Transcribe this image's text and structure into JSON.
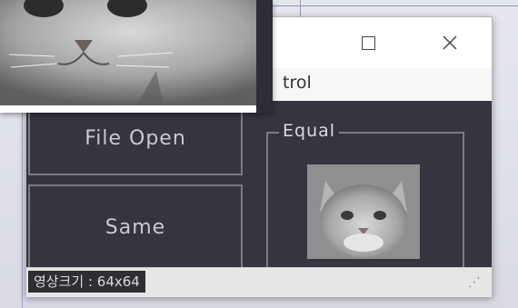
{
  "menu": {
    "partial_label": "trol"
  },
  "buttons": {
    "file_open": "File Open",
    "same": "Same"
  },
  "group": {
    "equal_label": "Equal"
  },
  "status": {
    "size_text": "영상크기 : 64x64"
  },
  "window_controls": {
    "maximize": "maximize",
    "close": "close"
  },
  "icons": {
    "maximize": "maximize-icon",
    "close": "close-icon",
    "resize_grip": "resize-grip-icon"
  },
  "colors": {
    "content_bg": "#35343f",
    "panel_border": "#7b7b85",
    "status_bg": "#2f2f33"
  }
}
